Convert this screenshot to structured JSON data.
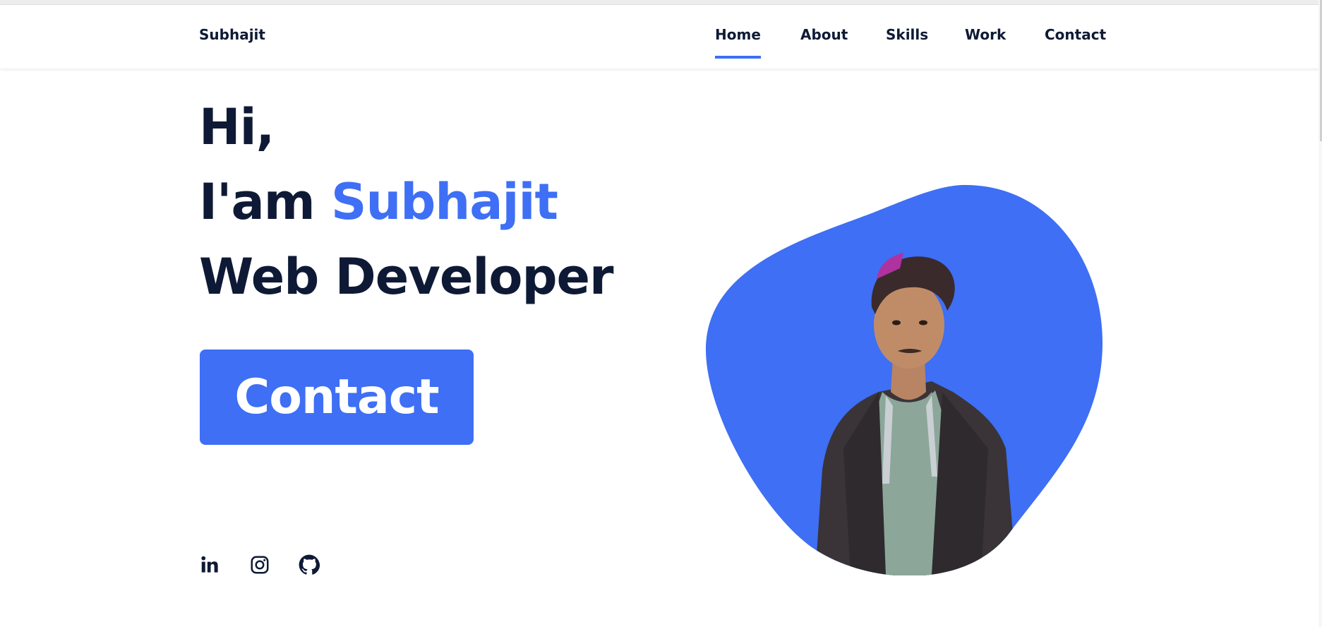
{
  "header": {
    "logo": "Subhajit",
    "nav": [
      {
        "label": "Home",
        "active": true
      },
      {
        "label": "About",
        "active": false
      },
      {
        "label": "Skills",
        "active": false
      },
      {
        "label": "Work",
        "active": false
      },
      {
        "label": "Contact",
        "active": false
      }
    ]
  },
  "hero": {
    "greeting": "Hi,",
    "intro_prefix": "I'am ",
    "name": "Subhajit",
    "role": "Web Developer",
    "button_label": "Contact"
  },
  "social": [
    {
      "icon": "linkedin-icon"
    },
    {
      "icon": "instagram-icon"
    },
    {
      "icon": "github-icon"
    }
  ],
  "colors": {
    "accent": "#3e6ff4",
    "text": "#0e1a35",
    "background": "#ffffff"
  }
}
